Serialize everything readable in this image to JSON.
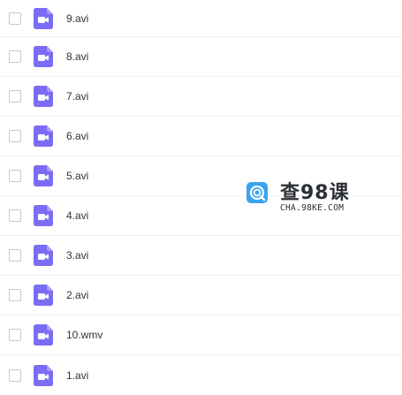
{
  "files": [
    {
      "name": "9.avi",
      "icon": "video-file-icon"
    },
    {
      "name": "8.avi",
      "icon": "video-file-icon"
    },
    {
      "name": "7.avi",
      "icon": "video-file-icon"
    },
    {
      "name": "6.avi",
      "icon": "video-file-icon"
    },
    {
      "name": "5.avi",
      "icon": "video-file-icon"
    },
    {
      "name": "4.avi",
      "icon": "video-file-icon"
    },
    {
      "name": "3.avi",
      "icon": "video-file-icon"
    },
    {
      "name": "2.avi",
      "icon": "video-file-icon"
    },
    {
      "name": "10.wmv",
      "icon": "video-file-icon"
    },
    {
      "name": "1.avi",
      "icon": "video-file-icon"
    }
  ],
  "watermark": {
    "title": "查98课",
    "subtitle": "CHA.98KE.COM",
    "logo_icon": "search-logo-icon"
  },
  "colors": {
    "icon_purple": "#7b6cf6",
    "logo_blue": "#3aa2f0",
    "divider": "#eef0f3",
    "text": "#333333"
  }
}
